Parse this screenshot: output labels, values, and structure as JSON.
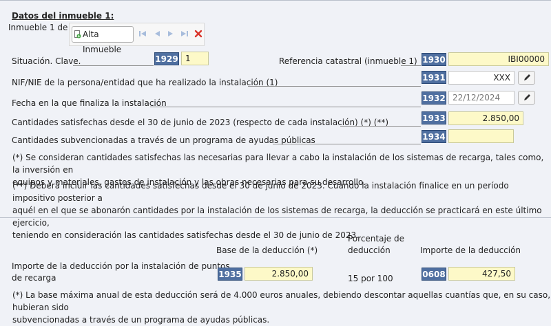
{
  "section": {
    "title": "Datos del inmueble 1:",
    "counter": "Inmueble 1 de 1"
  },
  "toolbar": {
    "add_label": "Alta Inmueble",
    "icons": [
      "add-icon",
      "first-icon",
      "previous-icon",
      "next-icon",
      "last-icon",
      "delete-icon"
    ]
  },
  "fields": {
    "situacion": {
      "label": "Situación. Clave.",
      "code": "1929",
      "value": "1"
    },
    "referencia": {
      "label": "Referencia catastral (inmueble 1)",
      "code": "1930",
      "value": "IBI00000"
    },
    "nif": {
      "label": "NIF/NIE de la persona/entidad que ha realizado la instalación (1)",
      "code": "1931",
      "value": "XXX"
    },
    "fecha": {
      "label": "Fecha en la que finaliza la instalación",
      "code": "1932",
      "value": "22/12/2024"
    },
    "cantidades": {
      "label": "Cantidades satisfechas desde el 30 de junio de 2023 (respecto de cada instalación) (*) (**)",
      "code": "1933",
      "value": "2.850,00"
    },
    "subvencionadas": {
      "label": "Cantidades subvencionadas a través de un programa de ayudas públicas",
      "code": "1934",
      "value": ""
    }
  },
  "notes": {
    "note1_line1": "(*) Se consideran cantidades satisfechas las necesarias para llevar a cabo la instalación de los sistemas de recarga, tales como, la inversión en",
    "note1_line2": "equipos y materiales, gastos de instalación y las obras necesarias para su desarrollo.",
    "note2_line1": "(**) Deberá incluir las cantidades satisfechas desde el 30 de junio de 2023. Cuando la instalación finalice en un período impositivo posterior a",
    "note2_line2": "aquél en el que se abonarón cantidades por la instalación de los sistemas de recarga, la deducción se practicará en este último ejercicio,",
    "note2_line3": "teniendo en consideración las cantidades satisfechas desde el 30 de junio de 2023."
  },
  "deduction": {
    "col_base": "Base de la deducción (*)",
    "col_pct_line1": "Porcentaje de",
    "col_pct_line2": "deducción",
    "col_importe": "Importe de la deducción",
    "row_label_line1": "Importe de la deducción por la instalación de puntos",
    "row_label_line2": "de recarga",
    "base_code": "1935",
    "base_value": "2.850,00",
    "pct_value": "15 por 100",
    "importe_code": "0608",
    "importe_value": "427,50",
    "footnote_line1": "(*) La base máxima anual de esta deducción será de 4.000 euros anuales, debiendo descontar aquellas cuantías que, en su caso, hubieran sido",
    "footnote_line2": "subvencionadas a través de un programa de ayudas públicas."
  },
  "colors": {
    "code_bg": "#4f6fa0",
    "field_bg": "#fdf9c8",
    "page_bg": "#f0f2f7",
    "delete": "#d9342b"
  }
}
